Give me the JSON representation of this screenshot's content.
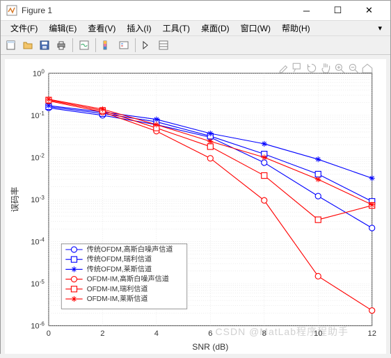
{
  "window": {
    "title": "Figure 1"
  },
  "menu": [
    "文件(F)",
    "编辑(E)",
    "查看(V)",
    "插入(I)",
    "工具(T)",
    "桌面(D)",
    "窗口(W)",
    "帮助(H)"
  ],
  "watermark": "CSDN @MatLab程序程助手",
  "chart_data": {
    "type": "line",
    "xlabel": "SNR (dB)",
    "ylabel": "误码率",
    "xlim": [
      0,
      12
    ],
    "ylim": [
      1e-06,
      1
    ],
    "yscale": "log",
    "xticks": [
      0,
      2,
      4,
      6,
      8,
      10,
      12
    ],
    "yticks": [
      1e-06,
      1e-05,
      0.0001,
      0.001,
      0.01,
      0.1,
      1
    ],
    "ytick_labels": [
      "10^{-6}",
      "10^{-5}",
      "10^{-4}",
      "10^{-3}",
      "10^{-2}",
      "10^{-1}",
      "10^{0}"
    ],
    "x": [
      0,
      2,
      4,
      6,
      8,
      10,
      12
    ],
    "legend_position": "southwest",
    "grid": true,
    "series": [
      {
        "name": "传统OFDM,高斯白噪声信道",
        "color": "#0000ff",
        "marker": "o",
        "values": [
          0.15,
          0.1,
          0.06,
          0.03,
          0.0075,
          0.0012,
          0.00021
        ]
      },
      {
        "name": "传统OFDM,瑞利信道",
        "color": "#0000ff",
        "marker": "s",
        "values": [
          0.16,
          0.11,
          0.07,
          0.032,
          0.012,
          0.004,
          0.0009
        ]
      },
      {
        "name": "传统OFDM,莱斯信道",
        "color": "#0000ff",
        "marker": "*",
        "values": [
          0.17,
          0.12,
          0.08,
          0.037,
          0.021,
          0.009,
          0.0032
        ]
      },
      {
        "name": "OFDM-IM,高斯白噪声信道",
        "color": "#ff0000",
        "marker": "o",
        "values": [
          0.22,
          0.12,
          0.042,
          0.0095,
          0.00095,
          1.5e-05,
          2.3e-06
        ]
      },
      {
        "name": "OFDM-IM,瑞利信道",
        "color": "#ff0000",
        "marker": "s",
        "values": [
          0.23,
          0.13,
          0.05,
          0.018,
          0.0037,
          0.00033,
          0.00072
        ]
      },
      {
        "name": "OFDM-IM,莱斯信道",
        "color": "#ff0000",
        "marker": "*",
        "values": [
          0.24,
          0.14,
          0.06,
          0.024,
          0.01,
          0.003,
          0.00075
        ]
      }
    ]
  }
}
